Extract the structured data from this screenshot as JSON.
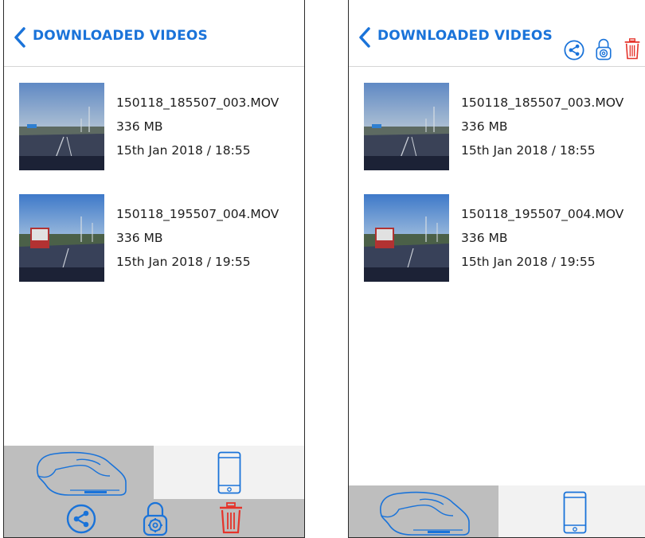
{
  "screens": [
    {
      "header": {
        "title": "DOWNLOADED VIDEOS"
      },
      "videos": [
        {
          "filename": "150118_185507_003.MOV",
          "size": "336 MB",
          "datetime": "15th Jan 2018 / 18:55"
        },
        {
          "filename": "150118_195507_004.MOV",
          "size": "336 MB",
          "datetime": "15th Jan 2018 / 19:55"
        }
      ],
      "tabs": [
        {
          "icon": "dashcam-icon",
          "selected": true
        },
        {
          "icon": "phone-icon",
          "selected": false
        }
      ],
      "actions": [
        "share-icon",
        "protect-lock-icon",
        "delete-trash-icon"
      ]
    },
    {
      "header": {
        "title": "DOWNLOADED VIDEOS"
      },
      "videos": [
        {
          "filename": "150118_185507_003.MOV",
          "size": "336 MB",
          "datetime": "15th Jan 2018 / 18:55"
        },
        {
          "filename": "150118_195507_004.MOV",
          "size": "336 MB",
          "datetime": "15th Jan 2018 / 19:55"
        }
      ],
      "tabs": [
        {
          "icon": "dashcam-icon",
          "selected": true
        },
        {
          "icon": "phone-icon",
          "selected": false
        }
      ],
      "actions": [
        "share-icon",
        "protect-lock-icon",
        "delete-trash-icon"
      ]
    }
  ],
  "colors": {
    "accent": "#1a73d9",
    "danger": "#e5332a",
    "tab_selected": "#bebebe",
    "tab_unselected": "#f2f2f2"
  }
}
